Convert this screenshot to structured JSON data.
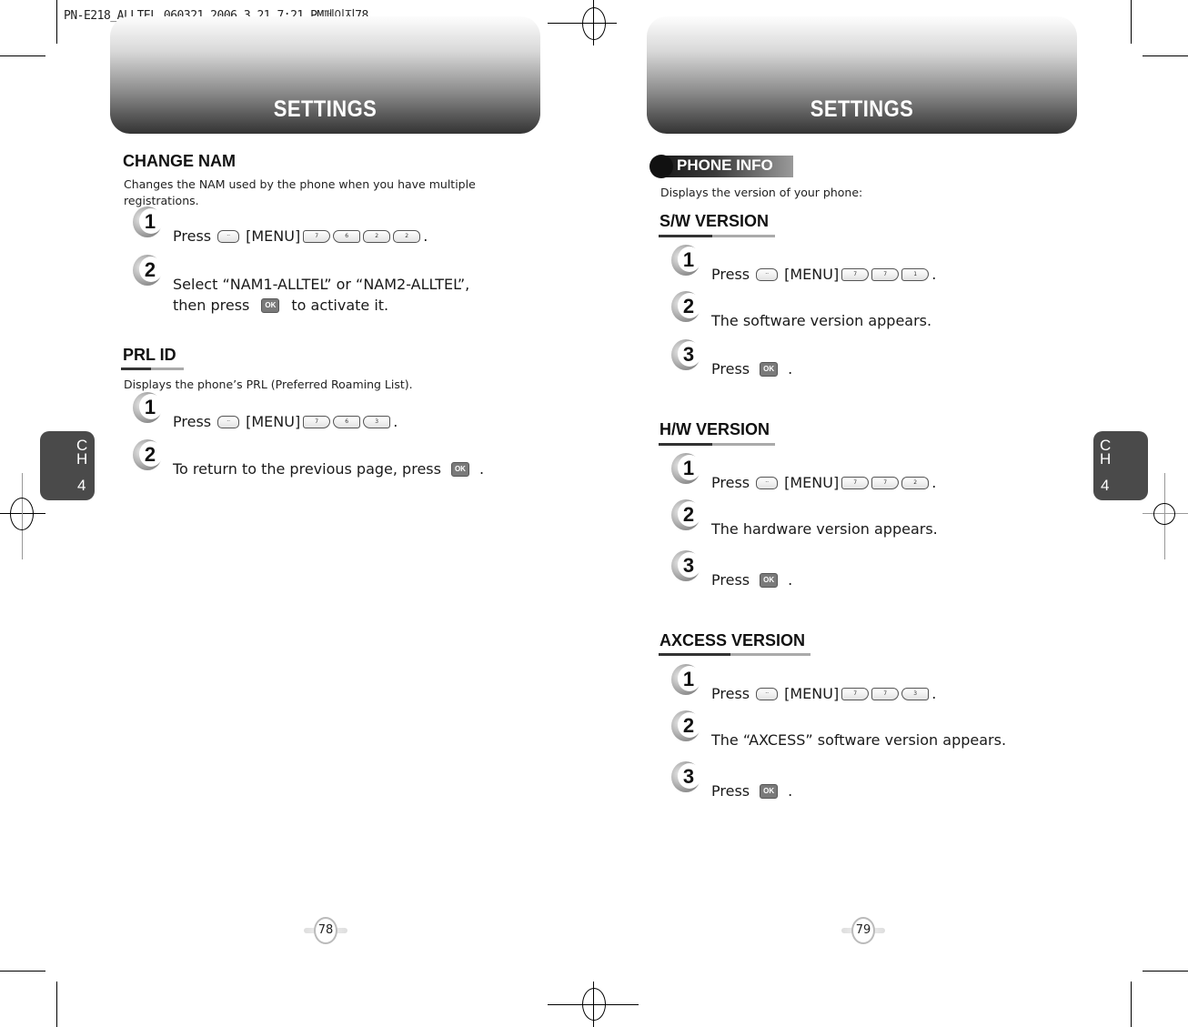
{
  "slug": "PN-E218_ALLTEL_060321  2006.3.21 7:21 PM페이지78",
  "left_page": {
    "header": "SETTINGS",
    "chapter_tab": {
      "c": "C",
      "h": "H",
      "n": "4"
    },
    "page_number": "78",
    "sections": [
      {
        "title": "CHANGE NAM",
        "description": "Changes the NAM used by the phone when you have multiple registrations.",
        "steps": [
          {
            "n": "1",
            "prefix": "Press",
            "menu_label": "[MENU]",
            "keys": [
              "7",
              "6",
              "2",
              "2"
            ],
            "suffix": "."
          },
          {
            "n": "2",
            "line1": "Select “NAM1-ALLTEL” or “NAM2-ALLTEL”,",
            "line2_prefix": "then press",
            "ok_label": "OK",
            "line2_suffix": "to activate it."
          }
        ]
      },
      {
        "title": "PRL ID",
        "description": "Displays the phone’s PRL (Preferred Roaming List).",
        "steps": [
          {
            "n": "1",
            "prefix": "Press",
            "menu_label": "[MENU]",
            "keys": [
              "7",
              "6",
              "3"
            ],
            "suffix": "."
          },
          {
            "n": "2",
            "prefix": "To return to the previous page, press",
            "ok_label": "OK",
            "suffix": "."
          }
        ]
      }
    ]
  },
  "right_page": {
    "header": "SETTINGS",
    "chapter_tab": {
      "c": "C",
      "h": "H",
      "n": "4"
    },
    "page_number": "79",
    "label": "PHONE INFO",
    "description": "Displays the version of your phone:",
    "sections": [
      {
        "title": "S/W VERSION",
        "steps": [
          {
            "n": "1",
            "prefix": "Press",
            "menu_label": "[MENU]",
            "keys": [
              "7",
              "7",
              "1"
            ],
            "suffix": "."
          },
          {
            "n": "2",
            "text": "The software version appears."
          },
          {
            "n": "3",
            "prefix": "Press",
            "ok_label": "OK",
            "suffix": "."
          }
        ]
      },
      {
        "title": "H/W VERSION",
        "steps": [
          {
            "n": "1",
            "prefix": "Press",
            "menu_label": "[MENU]",
            "keys": [
              "7",
              "7",
              "2"
            ],
            "suffix": "."
          },
          {
            "n": "2",
            "text": "The hardware version appears."
          },
          {
            "n": "3",
            "prefix": "Press",
            "ok_label": "OK",
            "suffix": "."
          }
        ]
      },
      {
        "title": "AXCESS VERSION",
        "steps": [
          {
            "n": "1",
            "prefix": "Press",
            "menu_label": "[MENU]",
            "keys": [
              "7",
              "7",
              "3"
            ],
            "suffix": "."
          },
          {
            "n": "2",
            "text": "The “AXCESS” software version appears."
          },
          {
            "n": "3",
            "prefix": "Press",
            "ok_label": "OK",
            "suffix": "."
          }
        ]
      }
    ]
  },
  "colors": {
    "tab_bg": "#4a4a4a",
    "heading_dark": "#333333",
    "heading_light": "#aaaaaa",
    "ok_key": "#7a7a7a"
  }
}
